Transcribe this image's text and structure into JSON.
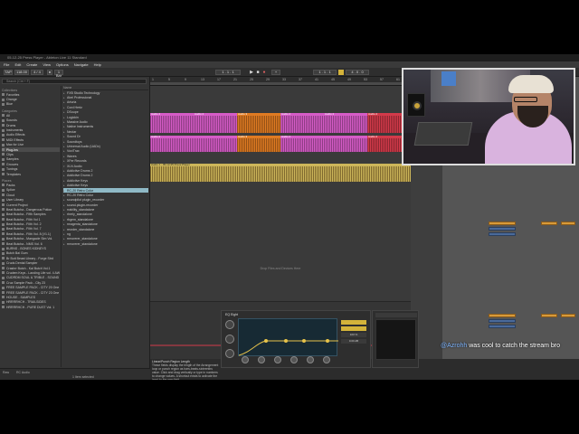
{
  "window": {
    "title": "05-12-25 Press Player - Ableton Live 11 Standard"
  },
  "menu": [
    "File",
    "Edit",
    "Create",
    "View",
    "Options",
    "Navigate",
    "Help"
  ],
  "transport": {
    "tempo": "118.00",
    "time_sig": "4 / 4",
    "position": "1 . 1 . 1",
    "loop_length": "4 . 0 . 0",
    "bar_display": "1 Bar",
    "key_label": "KEY",
    "cpu": "100 %"
  },
  "browser": {
    "search_placeholder": "Search (Ctrl + F)",
    "collections_head": "Collections",
    "collections": [
      "Favorites",
      "Orange",
      "Blue"
    ],
    "categories_head": "Categories",
    "categories": [
      "All",
      "Sounds",
      "Drums",
      "Instruments",
      "Audio Effects",
      "MIDI Effects",
      "Max for Live",
      "Plug-Ins",
      "Clips",
      "Samples",
      "Grooves",
      "Tunings",
      "Templates"
    ],
    "places_head": "Places",
    "places": [
      "Packs",
      "Splice",
      "Cloud",
      "User Library",
      "Current Project",
      "Beat Butcha - Dangerous Potion",
      "Beat Butcha - Fifth Samples",
      "Beat Butcha - Filth Vol 1",
      "Beat Butcha - Filth Vol. 2",
      "Beat Butcha - Filth Vol. 7",
      "Beat Butcha - Filth Vol. 8 (V1.1)",
      "Beat Butcha - Mangacle Sim Vol.",
      "Beat Butcha - NMS Vol. 6",
      "BURNS - BONES KIDNEYS",
      "Butch Bai Gum",
      "Br Butt Beast Library - Forge Strd",
      "Cruds Dental Sampler",
      "Crashrr Butch - Kal Butch Vol.1",
      "Crudem Keys - Landing Life vol. 4 AW",
      "CUDRDM SOUL & TRIBLE - SOUND 2",
      "Cruz Sample Pack - City 23",
      "FREE SAMPLE PACK - CITY 20 One",
      "FREE SAMPLE PACK - CITY 23 One",
      "HOUSE - SAMPLES",
      "HRRRRHCH - TRAILSIDES",
      "HRRRRHCH - PURE DUST Vol. 1"
    ],
    "names_head": "Name",
    "names": [
      {
        "t": "FXB Studio Technology",
        "open": false
      },
      {
        "t": "Abel Professional",
        "open": false
      },
      {
        "t": "Arturia",
        "open": false
      },
      {
        "t": "Cord Hertz",
        "open": false
      },
      {
        "t": "DSoupe",
        "open": false
      },
      {
        "t": "Logickin",
        "open": false
      },
      {
        "t": "Massive Audio",
        "open": false
      },
      {
        "t": "Native Instruments",
        "open": false
      },
      {
        "t": "Nectar",
        "open": false
      },
      {
        "t": "Sound Dr",
        "open": false
      },
      {
        "t": "Soundtoys",
        "open": false
      },
      {
        "t": "Universal Audio (UADx)",
        "open": false
      },
      {
        "t": "Vox/Trax",
        "open": false
      },
      {
        "t": "Waves",
        "open": false
      },
      {
        "t": "XFer Records",
        "open": false
      },
      {
        "t": "XLN Audio",
        "open": true
      },
      {
        "t": "Addictive Drums 2",
        "open": false
      },
      {
        "t": "Addictive Drums 2",
        "open": false
      },
      {
        "t": "Addictive Keys",
        "open": false
      },
      {
        "t": "Addictive Keys",
        "open": false
      },
      {
        "t": "RC-20 Retro Color",
        "open": false,
        "sel": true
      },
      {
        "t": "RC-20 Retro Color",
        "open": false
      },
      {
        "t": "soundpilot plugin_recorder",
        "open": false
      },
      {
        "t": "sound-plugin-recorder",
        "open": false
      },
      {
        "t": "rrability_standalone",
        "open": false
      },
      {
        "t": "rhrely_standalone",
        "open": false
      },
      {
        "t": "rbgem_standalone",
        "open": false
      },
      {
        "t": "rmagenta_standalone",
        "open": false
      },
      {
        "t": "reorder_standalone",
        "open": false
      },
      {
        "t": "ng",
        "open": false
      },
      {
        "t": "rrmorerer_standalone",
        "open": false
      },
      {
        "t": "rrmorerer_standalone",
        "open": false
      }
    ],
    "footer_label": "Raw",
    "footer_value": "RC Audio",
    "selected_count": "1 Item selected"
  },
  "arrangement": {
    "bars": [
      "1",
      "5",
      "9",
      "13",
      "17",
      "21",
      "25",
      "29",
      "33",
      "37",
      "41",
      "45",
      "49",
      "53",
      "57",
      "61"
    ],
    "drop_text": "Drop Files and Devices Here",
    "clip_pink": "Audio 2",
    "clip_orange": "Audio 3",
    "clip_yellow": "Audio 1 - 05-12-25 Press Player"
  },
  "detail": {
    "info_title": "Linear/Punch Region Length",
    "info_body": "These fields display the length of the Arrangement loop or punch region as bars-beats-sixteenths value. Click and drag vertically or type in numbers to change values. A shortcut exists to activate the input to the new field.",
    "eq_title": "EQ Eight",
    "eq_gain_label": "0.00 dB",
    "scale_label": "100 %"
  },
  "chat": {
    "user": "@Azrohh",
    "message": "was cool to catch the stream bro"
  },
  "colors": {
    "accent": "#d4b33a",
    "pink": "#d65cc7",
    "orange": "#e07b22",
    "yellow": "#d8c04a",
    "red": "#d33a4a"
  }
}
